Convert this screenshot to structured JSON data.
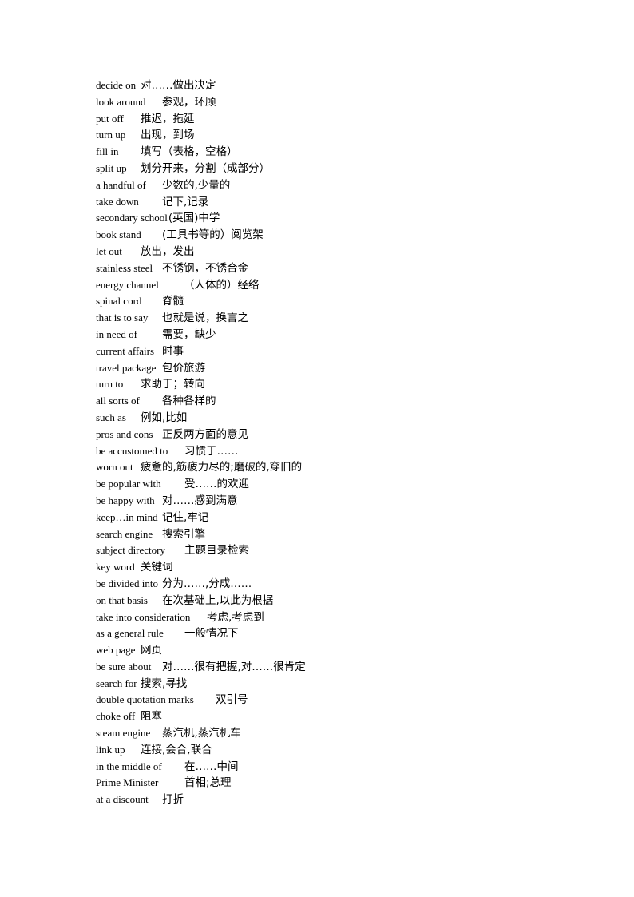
{
  "document": {
    "entries": [
      {
        "phrase": "decide on",
        "meaning": "对……做出决定"
      },
      {
        "phrase": "look around",
        "meaning": "参观，环顾"
      },
      {
        "phrase": "put off",
        "meaning": "推迟，拖延"
      },
      {
        "phrase": "turn up",
        "meaning": "出现，到场"
      },
      {
        "phrase": "fill in",
        "meaning": "填写（表格，空格）"
      },
      {
        "phrase": "split up",
        "meaning": "划分开来，分割（成部分）"
      },
      {
        "phrase": "a handful of",
        "meaning": "少数的,少量的"
      },
      {
        "phrase": "take down",
        "meaning": "记下,记录"
      },
      {
        "phrase": "secondary school",
        "meaning": "(英国)中学"
      },
      {
        "phrase": "book stand",
        "meaning": "(工具书等的）阅览架"
      },
      {
        "phrase": "let out",
        "meaning": "放出，发出"
      },
      {
        "phrase": "stainless steel",
        "meaning": "不锈钢，不锈合金"
      },
      {
        "phrase": "energy channel",
        "meaning": "（人体的）经络"
      },
      {
        "phrase": "spinal cord",
        "meaning": "脊髓"
      },
      {
        "phrase": "that is to say",
        "meaning": "也就是说，换言之"
      },
      {
        "phrase": "in need of",
        "meaning": "需要，缺少"
      },
      {
        "phrase": "current affairs",
        "meaning": "时事"
      },
      {
        "phrase": "travel package",
        "meaning": "包价旅游"
      },
      {
        "phrase": "turn to",
        "meaning": "求助于；转向"
      },
      {
        "phrase": "all sorts of",
        "meaning": "各种各样的"
      },
      {
        "phrase": "such as",
        "meaning": "例如,比如"
      },
      {
        "phrase": "pros and cons",
        "meaning": "正反两方面的意见"
      },
      {
        "phrase": "be accustomed to",
        "meaning": "习惯于……"
      },
      {
        "phrase": "worn out",
        "meaning": "疲惫的,筋疲力尽的;磨破的,穿旧的"
      },
      {
        "phrase": "be popular with",
        "meaning": "受……的欢迎"
      },
      {
        "phrase": "be happy with",
        "meaning": "对……感到满意"
      },
      {
        "phrase": "keep…in mind",
        "meaning": "记住,牢记"
      },
      {
        "phrase": "search engine",
        "meaning": "搜索引擎"
      },
      {
        "phrase": "subject directory",
        "meaning": "主题目录检索"
      },
      {
        "phrase": "key word",
        "meaning": "关键词"
      },
      {
        "phrase": "be divided into",
        "meaning": "分为……,分成……"
      },
      {
        "phrase": "on that basis",
        "meaning": "在次基础上,以此为根据"
      },
      {
        "phrase": "take into consideration",
        "meaning": "考虑,考虑到"
      },
      {
        "phrase": "as a general rule",
        "meaning": "一般情况下"
      },
      {
        "phrase": "web page",
        "meaning": "网页"
      },
      {
        "phrase": "be sure about",
        "meaning": "对……很有把握,对……很肯定"
      },
      {
        "phrase": "search for",
        "meaning": "搜索,寻找"
      },
      {
        "phrase": "double quotation marks",
        "meaning": "双引号"
      },
      {
        "phrase": "choke off",
        "meaning": "阻塞"
      },
      {
        "phrase": "steam engine",
        "meaning": "蒸汽机,蒸汽机车"
      },
      {
        "phrase": "link up",
        "meaning": "连接,会合,联合"
      },
      {
        "phrase": "in the middle of",
        "meaning": "在……中间"
      },
      {
        "phrase": "Prime Minister",
        "meaning": "首相;总理"
      },
      {
        "phrase": "at a discount",
        "meaning": "打折"
      }
    ]
  }
}
